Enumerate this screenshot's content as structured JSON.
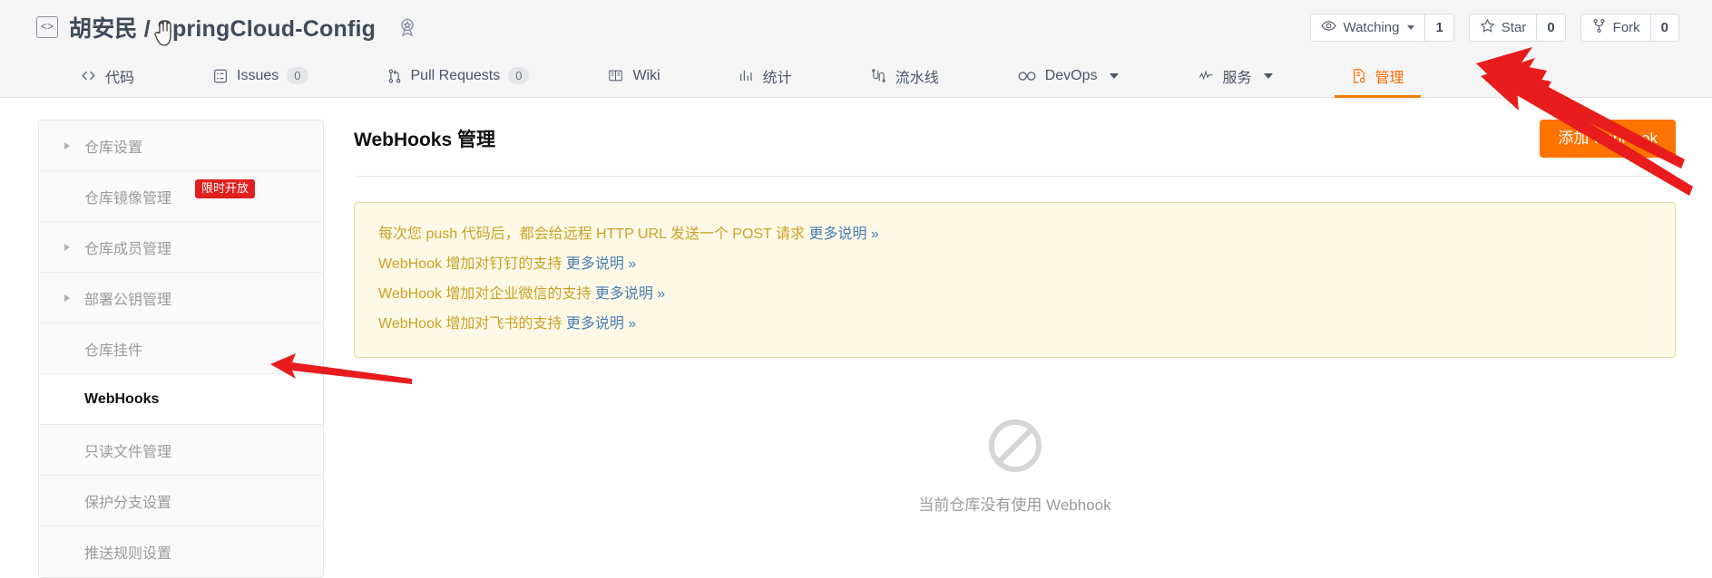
{
  "header": {
    "repo_icon": "code-brackets-icon",
    "owner": "胡安民",
    "separator": "/",
    "repo": "SpringCloud-Config",
    "award_icon": "award-badge-icon",
    "watch": {
      "label": "Watching",
      "count": "1",
      "icon": "eye-icon"
    },
    "star": {
      "label": "Star",
      "count": "0",
      "icon": "star-icon"
    },
    "fork": {
      "label": "Fork",
      "count": "0",
      "icon": "fork-icon"
    }
  },
  "nav": {
    "items": [
      {
        "label": "代码",
        "icon": "code-icon",
        "badge": null,
        "caret": false,
        "active": false
      },
      {
        "label": "Issues",
        "icon": "issues-list-icon",
        "badge": "0",
        "caret": false,
        "active": false
      },
      {
        "label": "Pull Requests",
        "icon": "pull-request-icon",
        "badge": "0",
        "caret": false,
        "active": false
      },
      {
        "label": "Wiki",
        "icon": "book-icon",
        "badge": null,
        "caret": false,
        "active": false
      },
      {
        "label": "统计",
        "icon": "bar-chart-icon",
        "badge": null,
        "caret": false,
        "active": false
      },
      {
        "label": "流水线",
        "icon": "pipeline-icon",
        "badge": null,
        "caret": false,
        "active": false
      },
      {
        "label": "DevOps",
        "icon": "infinity-icon",
        "badge": null,
        "caret": true,
        "active": false
      },
      {
        "label": "服务",
        "icon": "activity-icon",
        "badge": null,
        "caret": true,
        "active": false
      },
      {
        "label": "管理",
        "icon": "settings-doc-icon",
        "badge": null,
        "caret": false,
        "active": true
      }
    ]
  },
  "sidebar": {
    "items": [
      {
        "label": "仓库设置",
        "expandable": true,
        "active": false,
        "badge": null
      },
      {
        "label": "仓库镜像管理",
        "expandable": false,
        "active": false,
        "badge": "限时开放"
      },
      {
        "label": "仓库成员管理",
        "expandable": true,
        "active": false,
        "badge": null
      },
      {
        "label": "部署公钥管理",
        "expandable": true,
        "active": false,
        "badge": null
      },
      {
        "label": "仓库挂件",
        "expandable": false,
        "active": false,
        "badge": null
      },
      {
        "label": "WebHooks",
        "expandable": false,
        "active": true,
        "badge": null
      },
      {
        "label": "只读文件管理",
        "expandable": false,
        "active": false,
        "badge": null
      },
      {
        "label": "保护分支设置",
        "expandable": false,
        "active": false,
        "badge": null
      },
      {
        "label": "推送规则设置",
        "expandable": false,
        "active": false,
        "badge": null
      }
    ]
  },
  "main": {
    "title": "WebHooks 管理",
    "add_button": "添加 webHook",
    "notice": [
      {
        "text": "每次您 push 代码后，都会给远程 HTTP URL 发送一个 POST 请求 ",
        "more": "更多说明 »"
      },
      {
        "text": "WebHook 增加对钉钉的支持 ",
        "more": "更多说明 »"
      },
      {
        "text": "WebHook 增加对企业微信的支持 ",
        "more": "更多说明 »"
      },
      {
        "text": "WebHook 增加对飞书的支持 ",
        "more": "更多说明 »"
      }
    ],
    "empty": {
      "icon": "no-entry-icon",
      "text": "当前仓库没有使用 Webhook"
    }
  },
  "annotations": {
    "arrow_color": "#e81c1c",
    "arrows": [
      {
        "name": "arrow-to-manage-tab"
      },
      {
        "name": "arrow-to-add-webhook-button"
      },
      {
        "name": "arrow-to-webhooks-sidebar-item"
      }
    ],
    "cursor": {
      "name": "hand-cursor"
    }
  }
}
